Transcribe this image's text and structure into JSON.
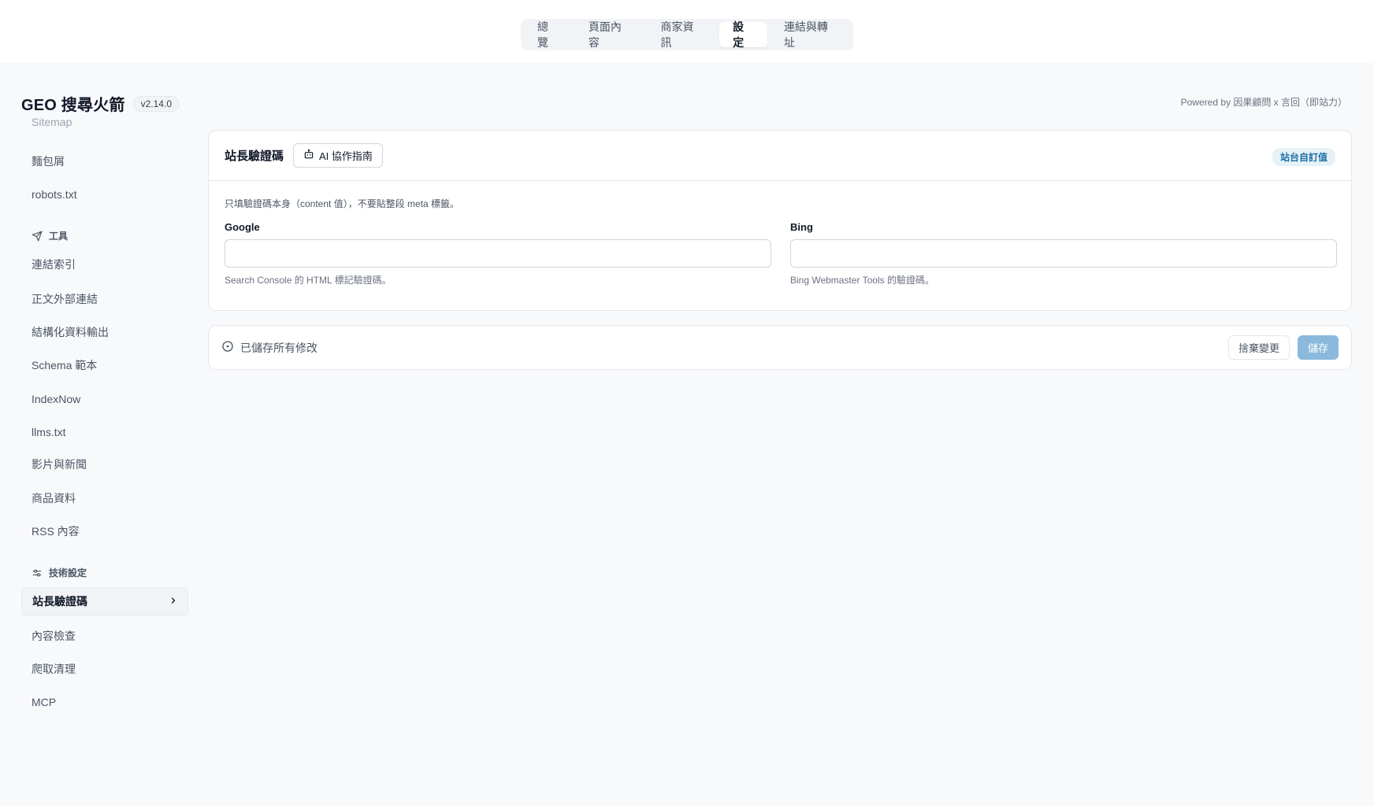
{
  "top_nav": {
    "tabs": [
      {
        "label": "總覽"
      },
      {
        "label": "頁面內容"
      },
      {
        "label": "商家資訊"
      },
      {
        "label": "設定"
      },
      {
        "label": "連結與轉址"
      }
    ],
    "active_tab": "設定"
  },
  "brand": {
    "title": "GEO 搜尋火箭",
    "version": "v2.14.0"
  },
  "powered_by": "Powered by 因果顧問 x 言回（即站力）",
  "sidebar": {
    "clipped_item": "Sitemap",
    "group1_items": [
      {
        "label": "麵包屑"
      },
      {
        "label": "robots.txt"
      }
    ],
    "tools_section": {
      "label": "工具",
      "icon": "send-icon",
      "items": [
        {
          "label": "連結索引"
        },
        {
          "label": "正文外部連結"
        },
        {
          "label": "結構化資料輸出"
        },
        {
          "label": "Schema 範本"
        },
        {
          "label": "IndexNow"
        },
        {
          "label": "llms.txt"
        },
        {
          "label": "影片與新聞"
        },
        {
          "label": "商品資料"
        },
        {
          "label": "RSS 內容"
        }
      ]
    },
    "tech_section": {
      "label": "技術設定",
      "icon": "sliders-icon",
      "items": [
        {
          "label": "站長驗證碼",
          "active": true
        },
        {
          "label": "內容檢查"
        },
        {
          "label": "爬取清理"
        },
        {
          "label": "MCP"
        }
      ]
    }
  },
  "card": {
    "title": "站長驗證碼",
    "ai_button": "AI 協作指南",
    "badge": "站台自訂值",
    "hint": "只填驗證碼本身（content 值），不要貼整段 meta 標籤。",
    "fields": [
      {
        "label": "Google",
        "value": "",
        "help": "Search Console 的 HTML 標記驗證碼。"
      },
      {
        "label": "Bing",
        "value": "",
        "help": "Bing Webmaster Tools 的驗證碼。"
      }
    ]
  },
  "savebar": {
    "status": "已儲存所有修改",
    "discard_label": "捨棄變更",
    "save_label": "儲存"
  },
  "colors": {
    "accent_badge_text": "#1d6fa8",
    "accent_badge_bg": "#e6f1f8",
    "save_button_bg": "#8ab9dc"
  }
}
